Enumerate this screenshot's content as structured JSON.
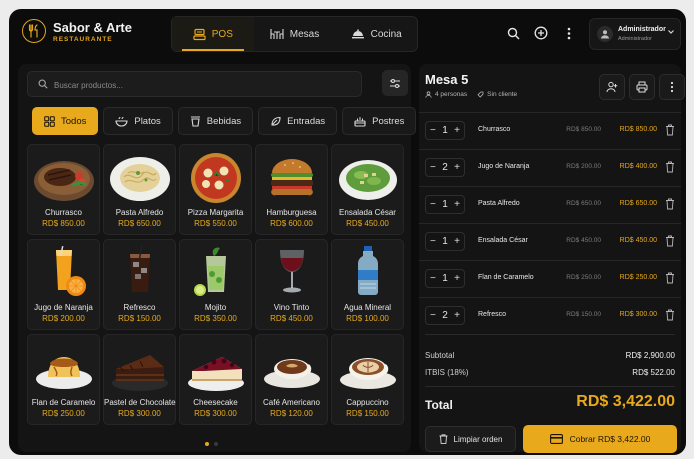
{
  "brand": {
    "name": "Sabor & Arte",
    "subtitle": "RESTAURANTE",
    "accent": "#e8a91c"
  },
  "nav": {
    "tabs": [
      {
        "label": "POS",
        "active": true,
        "icon": "register-icon"
      },
      {
        "label": "Mesas",
        "icon": "table-icon"
      },
      {
        "label": "Cocina",
        "icon": "cloche-icon"
      }
    ]
  },
  "header_icons": [
    "search-icon",
    "add-circle-icon",
    "more-vertical-icon"
  ],
  "user": {
    "name": "Administrador",
    "role": "Administrador"
  },
  "search": {
    "placeholder": "Buscar productos..."
  },
  "categories": [
    {
      "label": "Todos",
      "icon": "grid-icon",
      "active": true
    },
    {
      "label": "Platos",
      "icon": "bowl-icon"
    },
    {
      "label": "Bebidas",
      "icon": "cup-icon"
    },
    {
      "label": "Entradas",
      "icon": "leaf-icon"
    },
    {
      "label": "Postres",
      "icon": "cake-icon"
    }
  ],
  "products": [
    {
      "name": "Churrasco",
      "price": "RD$ 850.00",
      "art": "steak"
    },
    {
      "name": "Pasta Alfredo",
      "price": "RD$ 650.00",
      "art": "pasta"
    },
    {
      "name": "Pizza Margarita",
      "price": "RD$ 550.00",
      "art": "pizza"
    },
    {
      "name": "Hamburguesa",
      "price": "RD$ 600.00",
      "art": "burger"
    },
    {
      "name": "Ensalada César",
      "price": "RD$ 450.00",
      "art": "salad"
    },
    {
      "name": "Jugo de Naranja",
      "price": "RD$ 200.00",
      "art": "juice"
    },
    {
      "name": "Refresco",
      "price": "RD$ 150.00",
      "art": "soda"
    },
    {
      "name": "Mojito",
      "price": "RD$ 350.00",
      "art": "mojito"
    },
    {
      "name": "Vino Tinto",
      "price": "RD$ 450.00",
      "art": "wine"
    },
    {
      "name": "Agua Mineral",
      "price": "RD$ 100.00",
      "art": "water"
    },
    {
      "name": "Flan de Caramelo",
      "price": "RD$ 250.00",
      "art": "flan"
    },
    {
      "name": "Pastel de Chocolate",
      "price": "RD$ 300.00",
      "art": "choc"
    },
    {
      "name": "Cheesecake",
      "price": "RD$ 300.00",
      "art": "cheesecake"
    },
    {
      "name": "Café Americano",
      "price": "RD$ 120.00",
      "art": "coffee"
    },
    {
      "name": "Cappuccino",
      "price": "RD$ 150.00",
      "art": "cappuccino"
    }
  ],
  "pagination": {
    "pages": 2,
    "current": 1
  },
  "order": {
    "title": "Mesa 5",
    "guests": "4 personas",
    "client": "Sin cliente",
    "items": [
      {
        "qty": "1",
        "name": "Churrasco",
        "unit": "RD$ 850.00",
        "total": "RD$ 850.00"
      },
      {
        "qty": "2",
        "name": "Jugo de Naranja",
        "unit": "RD$ 200.00",
        "total": "RD$ 400.00"
      },
      {
        "qty": "1",
        "name": "Pasta Alfredo",
        "unit": "RD$ 650.00",
        "total": "RD$ 650.00"
      },
      {
        "qty": "1",
        "name": "Ensalada César",
        "unit": "RD$ 450.00",
        "total": "RD$ 450.00"
      },
      {
        "qty": "1",
        "name": "Flan de Caramelo",
        "unit": "RD$ 250.00",
        "total": "RD$ 250.00"
      },
      {
        "qty": "2",
        "name": "Refresco",
        "unit": "RD$ 150.00",
        "total": "RD$ 300.00"
      }
    ],
    "subtotal_label": "Subtotal",
    "subtotal": "RD$ 2,900.00",
    "tax_label": "ITBIS (18%)",
    "tax": "RD$ 522.00",
    "total_label": "Total",
    "total": "RD$ 3,422.00",
    "clear_label": "Limpiar orden",
    "pay_label": "Cobrar RD$ 3,422.00"
  }
}
